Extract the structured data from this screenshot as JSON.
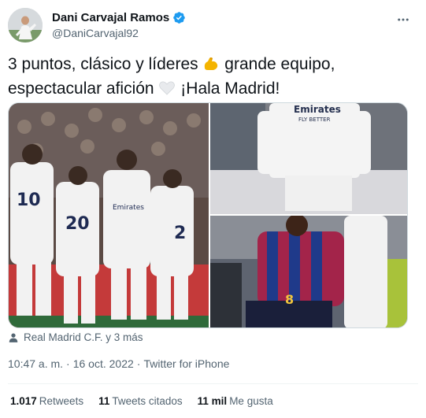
{
  "author": {
    "display_name": "Dani Carvajal Ramos",
    "handle": "@DaniCarvajal92",
    "avatar_icon": "profile-photo",
    "verified_icon": "verified-badge-icon",
    "verified_color": "#1d9bf0"
  },
  "tweet": {
    "text_part1": "3 puntos, clásico y líderes ",
    "text_part2": " grande equipo, espectacular afición ",
    "text_part3": " ¡Hala Madrid!",
    "emoji_1": "flexed-biceps-icon",
    "emoji_2": "white-heart-icon"
  },
  "media": {
    "photo_count": 3,
    "photo_1_jersey_text": "Emirates FLY BETTER",
    "photo_2_jersey_text": "Emirates FLY BETTER"
  },
  "tagged": {
    "icon": "person-icon",
    "text": "Real Madrid C.F. y 3 más"
  },
  "meta": {
    "time": "10:47 a. m.",
    "date": "16 oct. 2022",
    "source": "Twitter for iPhone",
    "separator": "·"
  },
  "stats": {
    "retweets_count": "1.017",
    "retweets_label": "Retweets",
    "quotes_count": "11",
    "quotes_label": "Tweets citados",
    "likes_count": "11 mil",
    "likes_label": "Me gusta"
  },
  "colors": {
    "text_primary": "#0f1419",
    "text_secondary": "#536471",
    "accent": "#1d9bf0",
    "border": "#cfd9de"
  }
}
